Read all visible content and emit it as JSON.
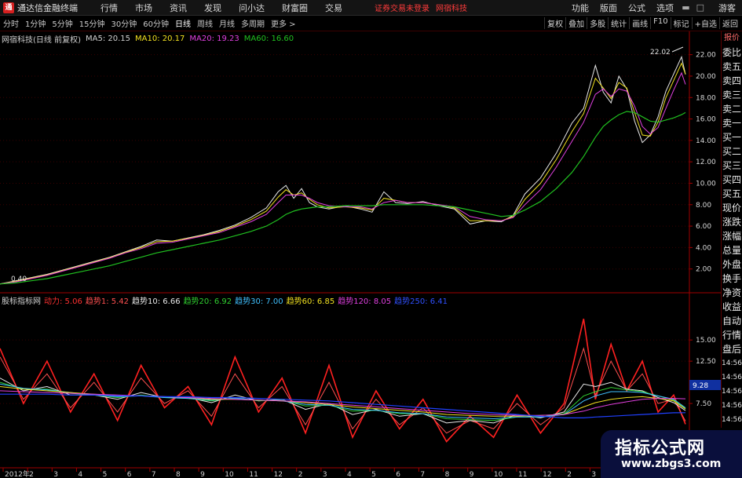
{
  "menubar": {
    "app_title": "通达信金融终端",
    "items": [
      "行情",
      "市场",
      "资讯",
      "发现",
      "问小达",
      "财富圈",
      "交易"
    ],
    "alert": "证券交易未登录",
    "alert_stock": "网宿科技",
    "right_items": [
      "功能",
      "版面",
      "公式",
      "选项"
    ],
    "guest": "游客"
  },
  "periodbar": {
    "periods": [
      "分时",
      "1分钟",
      "5分钟",
      "15分钟",
      "30分钟",
      "60分钟",
      "日线",
      "周线",
      "月线",
      "多周期",
      "更多 >"
    ],
    "active": "日线",
    "tools": [
      "复权",
      "叠加",
      "多股",
      "统计",
      "画线",
      "F10",
      "标记",
      "+自选",
      "返回"
    ]
  },
  "main_legend": {
    "title": "网宿科技(日线 前复权)",
    "ma5": "MA5: 20.15",
    "ma10": "MA10: 20.17",
    "ma20": "MA20: 19.23",
    "ma60": "MA60: 16.60"
  },
  "sub_legend": {
    "title": "股标指标网",
    "dongli": "动力: 5.06",
    "qushi1": "趋势1: 5.42",
    "qushi10": "趋势10: 6.66",
    "qushi20": "趋势20: 6.92",
    "qushi30": "趋势30: 7.00",
    "qushi60": "趋势60: 6.85",
    "qushi120": "趋势120: 8.05",
    "qushi250": "趋势250: 6.41"
  },
  "colors": {
    "ma5": "#e8e8e8",
    "ma10": "#f0e020",
    "ma20": "#e040e0",
    "ma60": "#20c020",
    "dongli": "#ff2020",
    "qushi250": "#2040ff",
    "axis": "#a00000"
  },
  "annotations": {
    "high_label": "22.02",
    "low_label": "0.40",
    "sub_current": "9.28",
    "year_label": "2012年"
  },
  "sidebar": {
    "top": "报价",
    "items": [
      "委比",
      "卖五",
      "卖四",
      "卖三",
      "卖二",
      "卖一",
      "买一",
      "买二",
      "买三",
      "买四",
      "买五",
      "现价",
      "涨跌",
      "涨幅",
      "总量",
      "外盘",
      "换手",
      "净资",
      "收益",
      "自动",
      "行情",
      "盘后",
      "14:56",
      "14:56",
      "14:56",
      "14:56",
      "14:56",
      "14:56",
      "14:56"
    ]
  },
  "watermark": {
    "line1": "指标公式网",
    "line2": "www.zbgs3.com"
  },
  "chart_data": [
    {
      "type": "line",
      "title": "网宿科技(日线 前复权)",
      "xlabel": "",
      "ylabel": "",
      "ylim": [
        0,
        23
      ],
      "yticks": [
        2.0,
        4.0,
        6.0,
        8.0,
        10.0,
        12.0,
        14.0,
        16.0,
        18.0,
        20.0,
        22.0
      ],
      "x": [
        0,
        20,
        40,
        60,
        80,
        100,
        120,
        140,
        160,
        180,
        200,
        220,
        240,
        260,
        280,
        300,
        320,
        340,
        355,
        365,
        375,
        385,
        395,
        405,
        420,
        440,
        460,
        475,
        490,
        505,
        520,
        540,
        560,
        580,
        600,
        620,
        640,
        655,
        670,
        690,
        710,
        730,
        745,
        760,
        770,
        780,
        790,
        800,
        810,
        820,
        830,
        840,
        850,
        860,
        870,
        875
      ],
      "series": [
        {
          "name": "MA5",
          "values": [
            0.6,
            0.9,
            1.2,
            1.5,
            1.9,
            2.3,
            2.7,
            3.1,
            3.6,
            4.1,
            4.7,
            4.6,
            4.9,
            5.2,
            5.6,
            6.1,
            6.8,
            7.7,
            9.2,
            9.8,
            8.6,
            9.5,
            8.2,
            7.8,
            7.6,
            7.9,
            7.6,
            7.3,
            9.2,
            8.2,
            8.1,
            8.3,
            7.9,
            7.6,
            6.2,
            6.5,
            6.4,
            7.0,
            9.0,
            10.5,
            12.8,
            15.6,
            17.0,
            21.0,
            18.5,
            17.5,
            20.0,
            18.8,
            15.8,
            13.8,
            14.5,
            16.2,
            18.6,
            20.2,
            21.8,
            20.15
          ]
        },
        {
          "name": "MA10",
          "values": [
            0.6,
            0.85,
            1.15,
            1.45,
            1.85,
            2.25,
            2.65,
            3.05,
            3.55,
            4.0,
            4.55,
            4.6,
            4.85,
            5.15,
            5.5,
            6.0,
            6.6,
            7.4,
            8.7,
            9.4,
            8.9,
            9.1,
            8.5,
            8.0,
            7.7,
            7.8,
            7.7,
            7.5,
            8.6,
            8.4,
            8.2,
            8.2,
            8.0,
            7.7,
            6.5,
            6.5,
            6.5,
            6.9,
            8.5,
            10.0,
            12.2,
            14.8,
            16.5,
            19.8,
            18.9,
            17.9,
            19.4,
            18.9,
            16.6,
            14.5,
            14.4,
            15.7,
            18.0,
            19.6,
            21.2,
            20.17
          ]
        },
        {
          "name": "MA20",
          "values": [
            0.6,
            0.8,
            1.1,
            1.4,
            1.8,
            2.2,
            2.6,
            3.0,
            3.5,
            3.9,
            4.4,
            4.5,
            4.8,
            5.1,
            5.4,
            5.9,
            6.4,
            7.1,
            8.2,
            8.9,
            8.9,
            8.9,
            8.6,
            8.2,
            7.9,
            7.8,
            7.8,
            7.6,
            8.2,
            8.4,
            8.2,
            8.2,
            8.0,
            7.8,
            6.9,
            6.6,
            6.5,
            6.8,
            8.0,
            9.4,
            11.5,
            13.9,
            15.7,
            18.3,
            18.8,
            18.1,
            18.8,
            18.6,
            17.2,
            15.3,
            14.6,
            15.2,
            17.0,
            18.7,
            20.3,
            19.23
          ]
        },
        {
          "name": "MA60",
          "values": [
            0.6,
            0.7,
            0.9,
            1.1,
            1.4,
            1.7,
            2.0,
            2.3,
            2.7,
            3.1,
            3.5,
            3.8,
            4.1,
            4.4,
            4.7,
            5.1,
            5.5,
            6.0,
            6.6,
            7.1,
            7.4,
            7.6,
            7.7,
            7.8,
            7.8,
            7.9,
            7.9,
            7.9,
            8.0,
            8.0,
            8.0,
            8.0,
            7.9,
            7.8,
            7.5,
            7.2,
            6.9,
            7.0,
            7.5,
            8.3,
            9.5,
            11.0,
            12.5,
            14.3,
            15.3,
            15.9,
            16.4,
            16.7,
            16.6,
            16.2,
            15.8,
            15.7,
            15.9,
            16.1,
            16.4,
            16.6
          ]
        }
      ]
    },
    {
      "type": "line",
      "title": "股标指标网",
      "xlabel": "",
      "ylabel": "",
      "ylim": [
        0,
        19
      ],
      "yticks": [
        7.5,
        12.5,
        15.0
      ],
      "x_tick_labels": [
        "2012年",
        "2",
        "3",
        "4",
        "5",
        "6",
        "7",
        "8",
        "9",
        "10",
        "11",
        "12",
        "2",
        "3",
        "4",
        "5",
        "6",
        "7",
        "8",
        "9",
        "10",
        "11",
        "12",
        "2",
        "3",
        "4",
        "5",
        "6"
      ],
      "x": [
        0,
        30,
        60,
        90,
        120,
        150,
        180,
        210,
        240,
        270,
        300,
        330,
        360,
        390,
        420,
        450,
        480,
        510,
        540,
        570,
        600,
        630,
        660,
        690,
        720,
        745,
        760,
        780,
        800,
        820,
        840,
        860,
        875
      ],
      "series": [
        {
          "name": "动力",
          "values": [
            14.0,
            7.5,
            12.5,
            6.5,
            11.0,
            5.5,
            12.0,
            7.0,
            9.5,
            5.0,
            13.0,
            6.5,
            10.5,
            4.0,
            12.0,
            3.5,
            9.0,
            4.5,
            8.0,
            3.0,
            6.0,
            3.5,
            8.5,
            4.0,
            7.5,
            17.5,
            8.0,
            14.5,
            9.0,
            12.5,
            6.5,
            8.5,
            5.06
          ]
        },
        {
          "name": "趋势1",
          "values": [
            13.0,
            8.0,
            11.0,
            7.0,
            10.0,
            6.5,
            10.5,
            7.5,
            9.0,
            6.0,
            11.0,
            7.0,
            9.5,
            5.0,
            10.0,
            4.5,
            8.0,
            5.0,
            7.0,
            4.0,
            5.5,
            4.5,
            7.5,
            5.0,
            7.0,
            14.0,
            8.5,
            12.5,
            9.0,
            11.0,
            7.5,
            8.0,
            5.42
          ]
        },
        {
          "name": "趋势10",
          "values": [
            10.5,
            9.0,
            9.5,
            8.5,
            8.5,
            8.0,
            8.8,
            8.2,
            8.2,
            7.6,
            8.5,
            7.8,
            8.0,
            6.8,
            7.5,
            6.2,
            6.8,
            6.0,
            6.3,
            5.2,
            5.5,
            5.2,
            6.2,
            5.8,
            6.5,
            9.8,
            9.5,
            10.0,
            9.2,
            9.0,
            8.2,
            7.6,
            6.66
          ]
        },
        {
          "name": "趋势20",
          "values": [
            10.0,
            9.2,
            9.2,
            8.7,
            8.5,
            8.2,
            8.5,
            8.2,
            8.1,
            7.8,
            8.2,
            7.8,
            7.9,
            7.2,
            7.3,
            6.6,
            6.7,
            6.3,
            6.3,
            5.7,
            5.6,
            5.5,
            5.9,
            5.9,
            6.3,
            8.4,
            8.9,
            9.4,
            9.1,
            8.9,
            8.4,
            7.9,
            6.92
          ]
        },
        {
          "name": "趋势30",
          "values": [
            9.8,
            9.3,
            9.1,
            8.8,
            8.5,
            8.3,
            8.4,
            8.2,
            8.1,
            7.9,
            8.1,
            7.9,
            7.8,
            7.4,
            7.3,
            6.8,
            6.7,
            6.4,
            6.3,
            5.9,
            5.8,
            5.7,
            5.9,
            5.9,
            6.2,
            7.8,
            8.4,
            8.9,
            8.9,
            8.8,
            8.4,
            8.0,
            7.0
          ]
        },
        {
          "name": "趋势60",
          "values": [
            9.5,
            9.2,
            9.0,
            8.8,
            8.6,
            8.4,
            8.4,
            8.3,
            8.2,
            8.0,
            8.0,
            7.9,
            7.8,
            7.6,
            7.4,
            7.1,
            6.9,
            6.7,
            6.5,
            6.2,
            6.1,
            6.0,
            6.0,
            6.1,
            6.2,
            7.1,
            7.6,
            8.0,
            8.2,
            8.3,
            8.1,
            7.8,
            6.85
          ]
        },
        {
          "name": "趋势120",
          "values": [
            9.0,
            8.9,
            8.8,
            8.7,
            8.6,
            8.5,
            8.4,
            8.3,
            8.2,
            8.1,
            8.0,
            7.9,
            7.8,
            7.7,
            7.5,
            7.3,
            7.1,
            6.9,
            6.7,
            6.5,
            6.3,
            6.2,
            6.1,
            6.1,
            6.2,
            6.6,
            7.0,
            7.4,
            7.7,
            8.0,
            8.1,
            8.1,
            8.05
          ]
        },
        {
          "name": "趋势250",
          "values": [
            8.6,
            8.6,
            8.6,
            8.5,
            8.5,
            8.4,
            8.4,
            8.3,
            8.3,
            8.2,
            8.2,
            8.1,
            8.0,
            7.9,
            7.8,
            7.6,
            7.4,
            7.2,
            7.0,
            6.8,
            6.6,
            6.4,
            6.2,
            6.0,
            5.8,
            5.8,
            5.9,
            6.0,
            6.1,
            6.2,
            6.3,
            6.4,
            6.41
          ]
        }
      ]
    }
  ]
}
